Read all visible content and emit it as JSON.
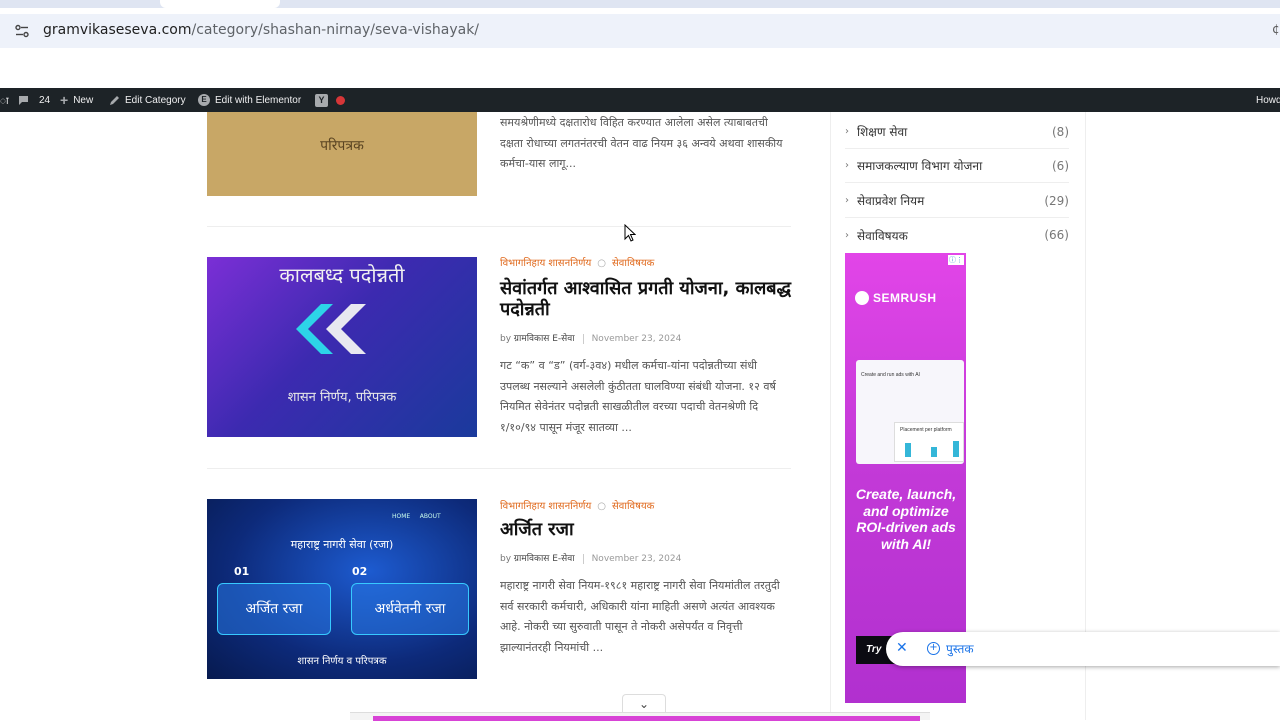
{
  "browser": {
    "url_host": "gramvikaseseva.com",
    "url_path": "/category/shashan-nirnay/seva-vishayak/"
  },
  "adminbar": {
    "left_partial": "ा",
    "comments_count": "24",
    "new_label": "New",
    "edit_category_label": "Edit Category",
    "elementor_label": "Edit with Elementor",
    "right_partial": "Howd"
  },
  "posts": [
    {
      "thumb_text": "परिपत्रक",
      "thumb_bg": "#c8a766",
      "excerpt": "समयश्रेणीमध्ये दक्षतारोध विहित करण्यात आलेला असेल त्याबाबतची दक्षता रोधाच्या लगतनंतरची वेतन वाढ नियम ३६ अन्वये अथवा शासकीय कर्मचा-यास लागू..."
    },
    {
      "cat1": "विभागनिहाय शासननिर्णय",
      "cat2": "सेवाविषयक",
      "title": "सेवांतर्गत आश्वासित प्रगती योजना, कालबद्ध पदोन्नती",
      "author": "ग्रामविकास E-सेवा",
      "date": "November 23, 2024",
      "thumb_title": "कालबध्द पदोन्नती",
      "thumb_sub": "शासन निर्णय, परिपत्रक",
      "excerpt": "गट “क” व “ड” (वर्ग-३व४) मधील कर्मचा-यांना पदोन्नतीच्या संधी उपलब्ध नसल्याने असलेली कुंठीतता घालविण्या संबंधी योजना. १२ वर्ष नियमित सेवेनंतर पदोन्नती साखळीतील वरच्या पदाची वेतनश्रेणी दि १/१०/९४ पासून मंजूर सातव्या ..."
    },
    {
      "cat1": "विभागनिहाय शासननिर्णय",
      "cat2": "सेवाविषयक",
      "title": "अर्जित रजा",
      "author": "ग्रामविकास E-सेवा",
      "date": "November 23, 2024",
      "thumb_header": "महाराष्ट्र नागरी सेवा (रजा)",
      "thumb_nav1": "HOME",
      "thumb_nav2": "ABOUT",
      "thumb_num1": "01",
      "thumb_num2": "02",
      "thumb_box1": "अर्जित रजा",
      "thumb_box2": "अर्धवेतनी रजा",
      "thumb_footer": "शासन निर्णय व परिपत्रक",
      "excerpt": "महाराष्ट्र नागरी सेवा नियम-१९८१ महाराष्ट्र नागरी सेवा नियमांतील तरतुदी सर्व सरकारी कर्मचारी, अधिकारी यांना माहिती असणे अत्यंत आवश्यक आहे. नोकरी च्या सुरुवाती पासून ते नोकरी असेपर्यंत व निवृत्ती झाल्यानंतरही नियमांची ..."
    }
  ],
  "sidebar": {
    "categories": [
      {
        "label": "शिक्षण सेवा",
        "count": "(8)"
      },
      {
        "label": "समाजकल्याण विभाग योजना",
        "count": "(6)"
      },
      {
        "label": "सेवाप्रवेश नियम",
        "count": "(29)"
      },
      {
        "label": "सेवाविषयक",
        "count": "(66)"
      }
    ]
  },
  "ad": {
    "brand": "SEMRUSH",
    "screenshot_title": "Create and run ads with AI",
    "screenshot_card": "Placement per platform",
    "headline": "Create, launch, and optimize ROI-driven ads with AI!",
    "cta": "Try"
  },
  "popup": {
    "label": "पुस्तक"
  },
  "colors": {
    "accent_orange": "#e06a1e",
    "adminbar_bg": "#1d2327",
    "ad_bg": "#d63fe2",
    "link_blue": "#1a73e8"
  }
}
